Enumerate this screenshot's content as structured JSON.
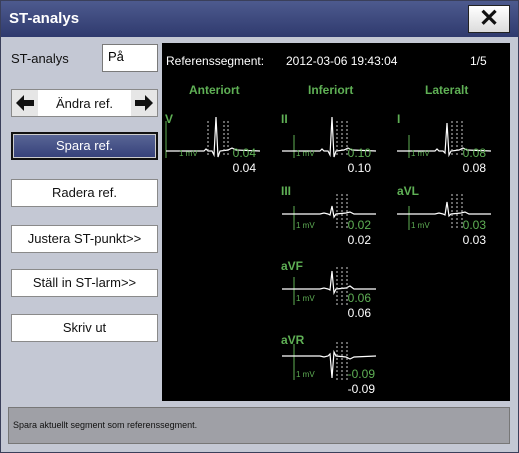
{
  "window": {
    "title": "ST-analys",
    "close_icon": "close-icon"
  },
  "st_analysis": {
    "label": "ST-analys",
    "value": "På"
  },
  "buttons": {
    "change_ref": "Ändra ref.",
    "save_ref": "Spara ref.",
    "delete_ref": "Radera ref.",
    "adjust_st": "Justera ST-punkt>>",
    "set_alarm": "Ställ in ST-larm>>",
    "print": "Skriv ut"
  },
  "panel": {
    "ref_label": "Referenssegment:",
    "timestamp": "2012-03-06 19:43:04",
    "page": "1/5",
    "columns": {
      "anterior": "Anteriort",
      "inferior": "Inferiort",
      "lateral": "Lateralt"
    },
    "mv_label": "1 mV",
    "leads": [
      {
        "name": "V",
        "value": "0.04",
        "ref": "0.04"
      },
      {
        "name": "II",
        "value": "0.10",
        "ref": "0.10"
      },
      {
        "name": "III",
        "value": "0.02",
        "ref": "0.02"
      },
      {
        "name": "aVF",
        "value": "0.06",
        "ref": "0.06"
      },
      {
        "name": "aVR",
        "value": "-0.09",
        "ref": "-0.09"
      },
      {
        "name": "I",
        "value": "0.08",
        "ref": "0.08"
      },
      {
        "name": "aVL",
        "value": "0.03",
        "ref": "0.03"
      }
    ]
  },
  "status": "Spara aktuellt segment som referenssegment.",
  "colors": {
    "title_bar": "#3b4679",
    "trace_green": "#5fb055",
    "panel_bg": "#000000"
  }
}
